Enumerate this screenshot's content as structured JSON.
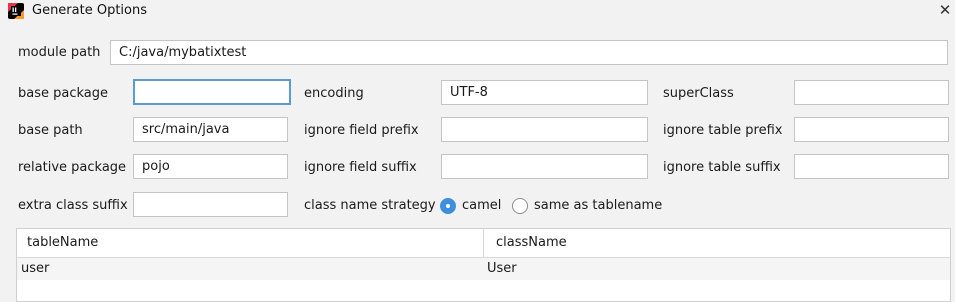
{
  "window": {
    "title": "Generate Options",
    "close_symbol": "✕",
    "app_icon": "intellij-icon"
  },
  "form": {
    "module_path": {
      "label": "module path",
      "value": "C:/java/mybatixtest"
    },
    "base_package": {
      "label": "base package",
      "value": ""
    },
    "encoding": {
      "label": "encoding",
      "value": "UTF-8"
    },
    "super_class": {
      "label": "superClass",
      "value": ""
    },
    "base_path": {
      "label": "base path",
      "value": "src/main/java"
    },
    "ignore_field_prefix": {
      "label": "ignore field prefix",
      "value": ""
    },
    "ignore_table_prefix": {
      "label": "ignore table prefix",
      "value": ""
    },
    "relative_package": {
      "label": "relative package",
      "value": "pojo"
    },
    "ignore_field_suffix": {
      "label": "ignore field suffix",
      "value": ""
    },
    "ignore_table_suffix": {
      "label": "ignore table suffix",
      "value": ""
    },
    "extra_class_suffix": {
      "label": "extra class suffix",
      "value": ""
    },
    "class_name_strategy": {
      "label": "class name strategy",
      "options": [
        {
          "label": "camel",
          "selected": true
        },
        {
          "label": "same as tablename",
          "selected": false
        }
      ]
    }
  },
  "table": {
    "columns": [
      "tableName",
      "className"
    ],
    "rows": [
      [
        "user",
        "User"
      ]
    ]
  },
  "colors": {
    "accent": "#3d8fde",
    "focus_border": "#5b9bd5",
    "background": "#f2f2f2"
  }
}
